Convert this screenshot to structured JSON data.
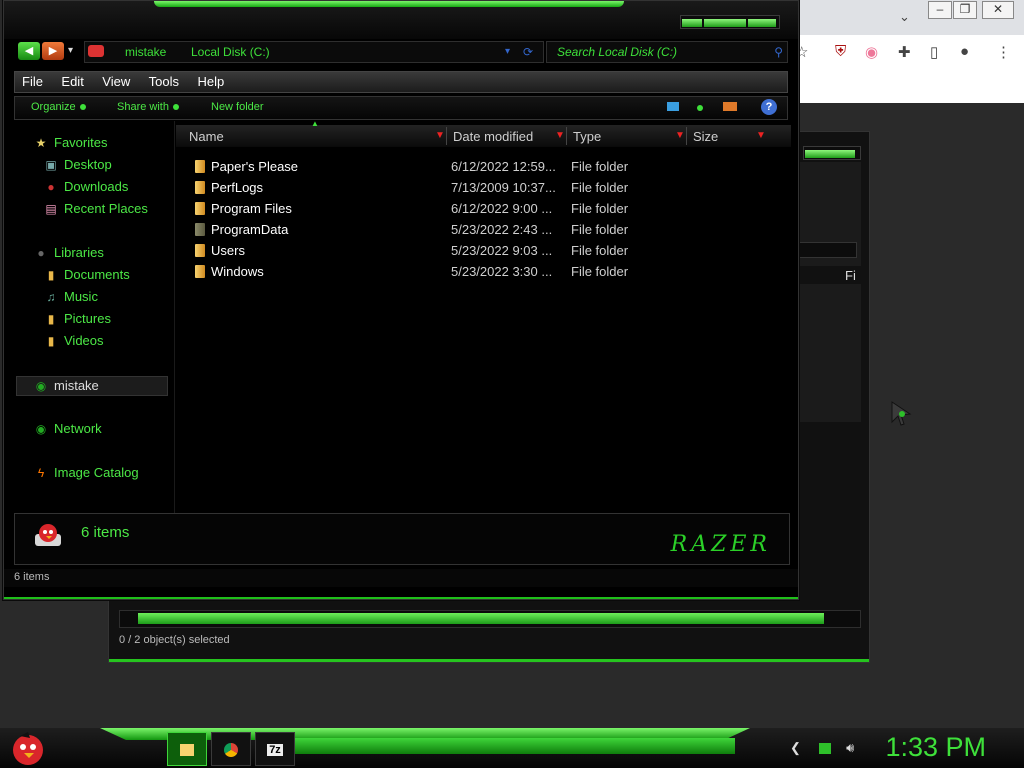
{
  "explorer": {
    "breadcrumb": [
      "mistake",
      "Local Disk (C:)"
    ],
    "search_placeholder": "Search Local Disk (C:)",
    "menu": [
      "File",
      "Edit",
      "View",
      "Tools",
      "Help"
    ],
    "toolbar": {
      "organize": "Organize",
      "share": "Share with",
      "new_folder": "New folder"
    },
    "nav": {
      "favorites": "Favorites",
      "desktop": "Desktop",
      "downloads": "Downloads",
      "recent": "Recent Places",
      "libraries": "Libraries",
      "documents": "Documents",
      "music": "Music",
      "pictures": "Pictures",
      "videos": "Videos",
      "user": "mistake",
      "network": "Network",
      "image_catalog": "Image Catalog"
    },
    "columns": {
      "name": "Name",
      "date": "Date modified",
      "type": "Type",
      "size": "Size"
    },
    "files": [
      {
        "name": "Paper's Please",
        "date": "6/12/2022 12:59...",
        "type": "File folder"
      },
      {
        "name": "PerfLogs",
        "date": "7/13/2009 10:37...",
        "type": "File folder"
      },
      {
        "name": "Program Files",
        "date": "6/12/2022 9:00 ...",
        "type": "File folder"
      },
      {
        "name": "ProgramData",
        "date": "5/23/2022 2:43 ...",
        "type": "File folder"
      },
      {
        "name": "Users",
        "date": "5/23/2022 9:03 ...",
        "type": "File folder"
      },
      {
        "name": "Windows",
        "date": "5/23/2022 3:30 ...",
        "type": "File folder"
      }
    ],
    "details_count": "6 items",
    "status": "6 items",
    "brand": "RAZER"
  },
  "backwin": {
    "status": "0 / 2 object(s) selected",
    "col_fragment": "Fi"
  },
  "taskbar": {
    "clock": "1:33 PM",
    "app3": "7z"
  },
  "colors": {
    "accent": "#3ee03a",
    "background": "#000000"
  }
}
